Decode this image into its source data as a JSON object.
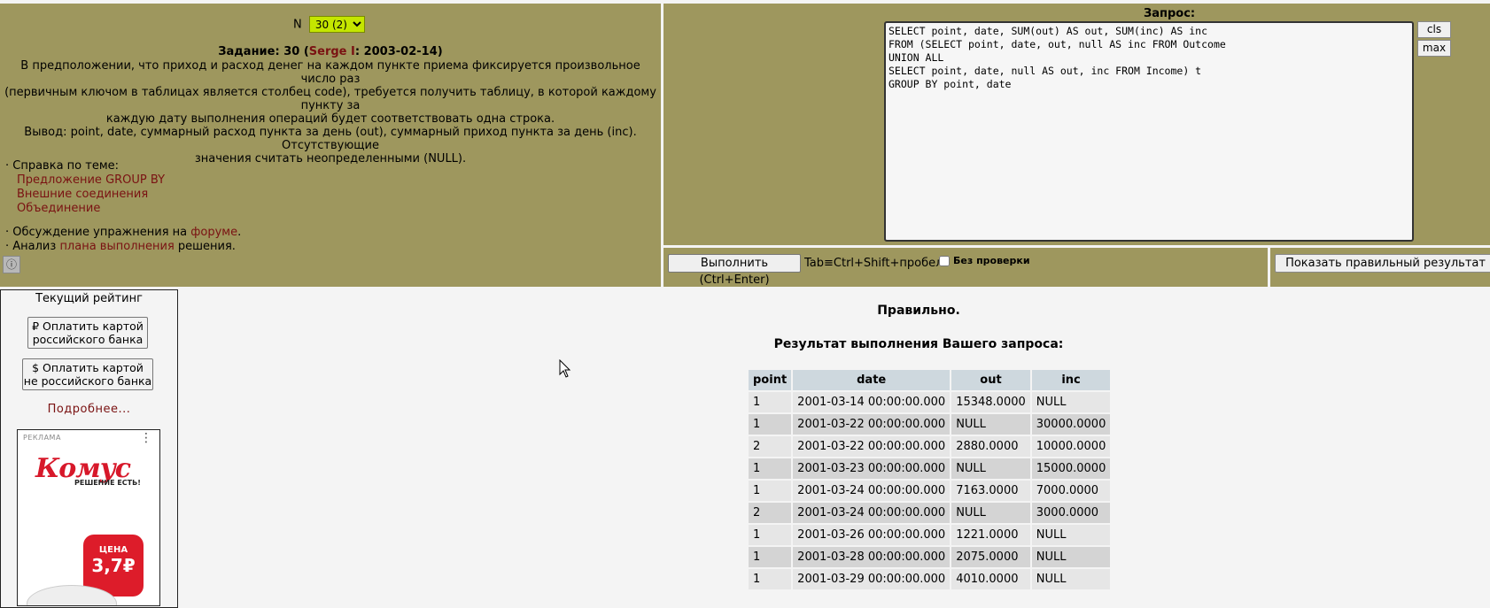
{
  "exercise": {
    "n_label": "N",
    "n_selected": "30 (2)",
    "title_prefix": "Задание: 30 (",
    "author": "Serge I",
    "title_suffix": ": 2003-02-14)",
    "text_lines": [
      "В предположении, что приход и расход денег на каждом пункте приема фиксируется произвольное число раз",
      "(первичным ключом в таблицах является столбец code), требуется получить таблицу, в которой каждому пункту за",
      "каждую дату выполнения операций будет соответствовать одна строка.",
      "Вывод: point, date, суммарный расход пункта за день (out), суммарный приход пункта за день (inc). Отсутствующие",
      "значения считать неопределенными (NULL)."
    ]
  },
  "help": {
    "heading": "· Справка по теме:",
    "links": [
      "Предложение GROUP BY",
      "Внешние соединения",
      "Объединение"
    ],
    "discussion_prefix": "· Обсуждение упражнения на ",
    "discussion_link": "форуме",
    "discussion_suffix": ".",
    "analysis_prefix": "· Анализ ",
    "analysis_link": "плана выполнения",
    "analysis_suffix": " решения."
  },
  "query": {
    "label": "Запрос:",
    "text": "SELECT point, date, SUM(out) AS out, SUM(inc) AS inc\nFROM (SELECT point, date, out, null AS inc FROM Outcome\nUNION ALL\nSELECT point, date, null AS out, inc FROM Income) t\nGROUP BY point, date",
    "cls_label": "cls",
    "max_label": "max",
    "run_label": "Выполнить (Ctrl+Enter)",
    "tab_hint": "Tab≡Ctrl+Shift+пробел",
    "no_verify_label": "Без  проверки",
    "show_correct_label": "Показать правильный результат"
  },
  "sidebar": {
    "rating_title": "Текущий рейтинг",
    "pay_ru": "₽ Оплатить картой российского банка",
    "pay_ru_line1": "₽ Оплатить картой",
    "pay_ru_line2": "российского банка",
    "pay_foreign_line1": "$ Оплатить картой",
    "pay_foreign_line2": "не российского банка",
    "more": "Подробнее...",
    "ad_label": "РЕКЛАМА",
    "ad_brand": "Комус",
    "ad_slogan": "РЕШЕНИЕ ЕСТЬ!",
    "ad_price_label": "ЦЕНА",
    "ad_price_value": "3,7₽"
  },
  "results": {
    "status": "Правильно.",
    "title": "Результат выполнения Вашего запроса:",
    "columns": [
      "point",
      "date",
      "out",
      "inc"
    ],
    "rows": [
      [
        "1",
        "2001-03-14 00:00:00.000",
        "15348.0000",
        "NULL"
      ],
      [
        "1",
        "2001-03-22 00:00:00.000",
        "NULL",
        "30000.0000"
      ],
      [
        "2",
        "2001-03-22 00:00:00.000",
        "2880.0000",
        "10000.0000"
      ],
      [
        "1",
        "2001-03-23 00:00:00.000",
        "NULL",
        "15000.0000"
      ],
      [
        "1",
        "2001-03-24 00:00:00.000",
        "7163.0000",
        "7000.0000"
      ],
      [
        "2",
        "2001-03-24 00:00:00.000",
        "NULL",
        "3000.0000"
      ],
      [
        "1",
        "2001-03-26 00:00:00.000",
        "1221.0000",
        "NULL"
      ],
      [
        "1",
        "2001-03-28 00:00:00.000",
        "2075.0000",
        "NULL"
      ],
      [
        "1",
        "2001-03-29 00:00:00.000",
        "4010.0000",
        "NULL"
      ]
    ]
  }
}
